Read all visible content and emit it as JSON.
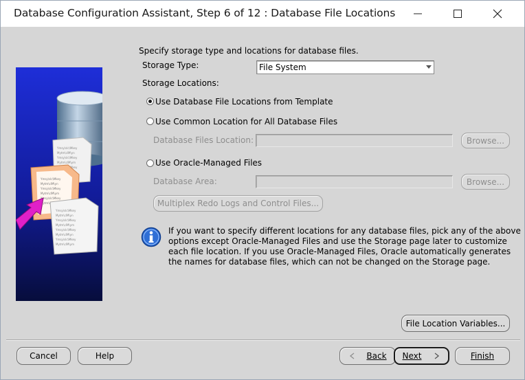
{
  "window": {
    "title": "Database Configuration Assistant, Step 6 of 12 : Database File Locations"
  },
  "intro": "Specify storage type and locations for database files.",
  "storage_type": {
    "label": "Storage Type:",
    "value": "File System"
  },
  "storage_locations_label": "Storage Locations:",
  "options": {
    "template": {
      "label": "Use Database File Locations from Template",
      "selected": true
    },
    "common": {
      "label": "Use Common Location for All Database Files",
      "selected": false,
      "field_label": "Database Files Location:",
      "field_value": "",
      "browse": "Browse..."
    },
    "omf": {
      "label": "Use Oracle-Managed Files",
      "selected": false,
      "field_label": "Database Area:",
      "field_value": "",
      "browse": "Browse...",
      "multiplex": "Multiplex Redo Logs and Control Files..."
    }
  },
  "info": {
    "lines": [
      "If you want to specify different locations for any database files, pick any of the above",
      "options except Oracle-Managed Files and use the Storage page later to customize",
      "each file location. If you use Oracle-Managed Files, Oracle automatically generates",
      "the names for database files, which can not be changed on the Storage page."
    ]
  },
  "file_location_variables": "File Location Variables...",
  "footer": {
    "cancel": "Cancel",
    "help": "Help",
    "back": "Back",
    "next": "Next",
    "finish": "Finish"
  },
  "doc_snippet_lines": [
    "Ymsy\\slc\\Mkey",
    "Mytm\\clM\\yn",
    "Mytm\\clM\\ym"
  ],
  "icons": {
    "minimize": "minimize-icon",
    "maximize": "maximize-icon",
    "close": "close-icon",
    "info": "info-icon",
    "back": "chevron-left-icon",
    "next": "chevron-right-icon"
  }
}
